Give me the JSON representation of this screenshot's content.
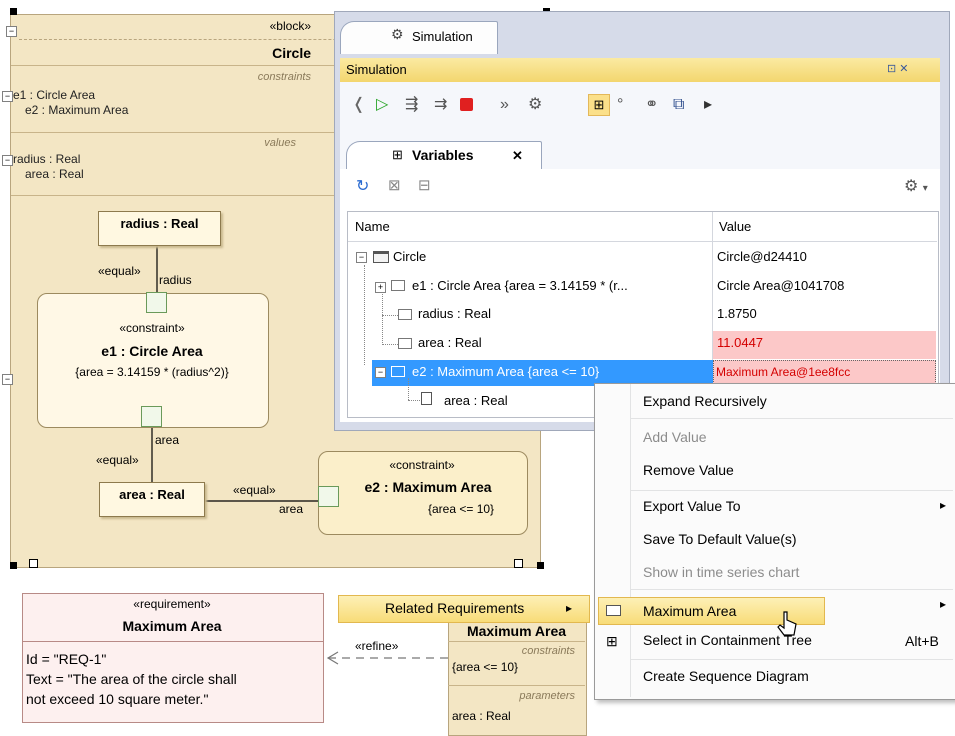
{
  "block": {
    "stereotype": "«block»",
    "name": "Circle",
    "constraints_caption": "constraints",
    "constraints": [
      "e1 : Circle Area",
      "e2 : Maximum Area"
    ],
    "values_caption": "values",
    "values": [
      "radius : Real",
      "area : Real"
    ],
    "toggle": "−"
  },
  "diagram": {
    "radius_part": "radius : Real",
    "area_part": "area : Real",
    "equal1": "«equal»",
    "radius_label": "radius",
    "equal2": "«equal»",
    "area_label1": "area",
    "equal3": "«equal»",
    "area_label2": "area",
    "e1": {
      "stereotype": "«constraint»",
      "name": "e1 : Circle Area",
      "expr": "{area = 3.14159 * (radius^2)}"
    },
    "e2": {
      "stereotype": "«constraint»",
      "name": "e2 : Maximum Area",
      "expr": "{area <= 10}"
    }
  },
  "requirement": {
    "stereotype": "«requirement»",
    "name": "Maximum Area",
    "id": "Id = \"REQ-1\"",
    "text_line1": "Text = \"The area of the circle shall",
    "text_line2": "not exceed 10 square meter.\""
  },
  "refine_label": "«refine»",
  "hidden_block": {
    "name": "Maximum Area",
    "constraints_caption": "constraints",
    "expr": "{area <= 10}",
    "parameters_caption": "parameters",
    "param": "area : Real"
  },
  "sim_panel": {
    "tab": "Simulation",
    "title": "Simulation",
    "title_buttons": "⊡ ✕",
    "variables_tab": "Variables",
    "variables_close": "✕",
    "columns": [
      "Name",
      "Value"
    ],
    "rows": [
      {
        "name": "Circle",
        "value": "Circle@d24410",
        "toggle": "−"
      },
      {
        "name": "e1 : Circle Area {area = 3.14159 * (r...",
        "value": "Circle Area@1041708",
        "toggle": "+"
      },
      {
        "name": "radius : Real",
        "value": "1.8750"
      },
      {
        "name": "area : Real",
        "value": "11.0447"
      },
      {
        "name": "e2 : Maximum Area {area <= 10}",
        "value": "Maximum Area@1ee8fcc",
        "toggle": "−"
      },
      {
        "name": "area : Real",
        "value": ""
      }
    ],
    "colors": {
      "highlight_row": "#fcc8c8",
      "highlight_text": "#d40000",
      "selected": "#3399ff"
    }
  },
  "context_menu": {
    "items": [
      {
        "label": "Expand Recursively",
        "enabled": true
      },
      {
        "label": "Add Value",
        "enabled": false
      },
      {
        "label": "Remove Value",
        "enabled": true
      },
      {
        "label": "Export Value To",
        "enabled": true,
        "submenu": true
      },
      {
        "label": "Save To Default Value(s)",
        "enabled": true
      },
      {
        "label": "Show in time series chart",
        "enabled": false
      },
      {
        "label": "Related Requirements",
        "enabled": true,
        "submenu": true
      },
      {
        "label": "Select in Containment Tree",
        "enabled": true,
        "shortcut": "Alt+B"
      },
      {
        "label": "Create Sequence Diagram",
        "enabled": true
      }
    ],
    "submenu_item": "Maximum Area",
    "arrow": "▸"
  }
}
